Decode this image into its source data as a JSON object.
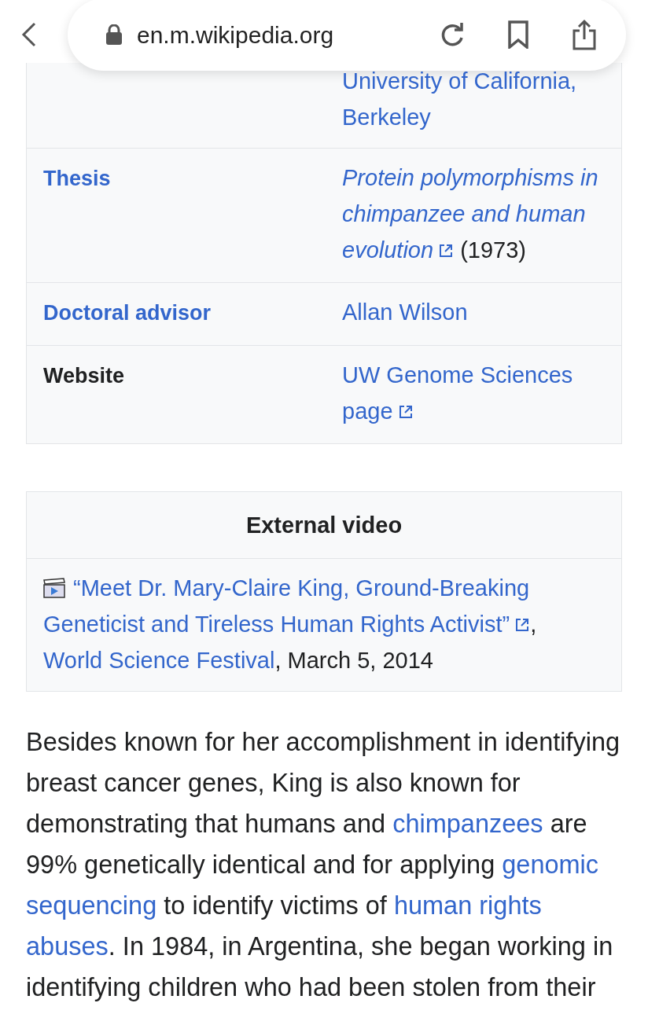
{
  "browser": {
    "url": "en.m.wikipedia.org"
  },
  "infobox": {
    "rows": [
      {
        "label": null,
        "value": [
          [
            {
              "kind": "link",
              "text": "University of California,"
            }
          ],
          [
            {
              "kind": "link",
              "text": "Berkeley"
            }
          ]
        ]
      },
      {
        "label": {
          "text": "Thesis",
          "link": true
        },
        "value": [
          [
            {
              "kind": "link",
              "italic": true,
              "text": "Protein polymorphisms in"
            }
          ],
          [
            {
              "kind": "link",
              "italic": true,
              "text": "chimpanzee and human"
            }
          ],
          [
            {
              "kind": "link",
              "italic": true,
              "external": true,
              "text": "evolution"
            },
            {
              "kind": "text",
              "text": " (1973)"
            }
          ]
        ]
      },
      {
        "label": {
          "text": "Doctoral advisor",
          "link": true
        },
        "value": [
          [
            {
              "kind": "link",
              "text": "Allan Wilson"
            }
          ]
        ]
      },
      {
        "label": {
          "text": "Website",
          "link": false
        },
        "value": [
          [
            {
              "kind": "link",
              "text": "UW Genome Sciences"
            }
          ],
          [
            {
              "kind": "link",
              "external": true,
              "text": "page"
            }
          ]
        ]
      }
    ]
  },
  "external_video": {
    "title": "External video",
    "content": [
      [
        {
          "kind": "link",
          "text": "“Meet Dr. Mary-Claire King, Ground-Breaking"
        }
      ],
      [
        {
          "kind": "link",
          "external": true,
          "text": "Geneticist and Tireless Human Rights Activist”"
        },
        {
          "kind": "text",
          "text": ","
        }
      ],
      [
        {
          "kind": "link",
          "text": "World Science Festival"
        },
        {
          "kind": "text",
          "text": ", March 5, 2014"
        }
      ]
    ]
  },
  "paragraph": [
    {
      "kind": "text",
      "text": "Besides known for her accomplishment in identifying breast cancer genes, King is also known for demonstrating that humans and "
    },
    {
      "kind": "link",
      "text": "chimpanzees"
    },
    {
      "kind": "text",
      "text": " are 99% genetically identical and for applying "
    },
    {
      "kind": "link",
      "text": "genomic",
      "continues": true
    },
    {
      "kind": "link",
      "text": "sequencing"
    },
    {
      "kind": "text",
      "text": " to identify victims of "
    },
    {
      "kind": "link",
      "text": "human rights",
      "continues": true
    },
    {
      "kind": "link",
      "text": "abuses"
    },
    {
      "kind": "text",
      "text": ". In 1984, in Argentina, she began working in identifying children who had been stolen from their"
    }
  ]
}
